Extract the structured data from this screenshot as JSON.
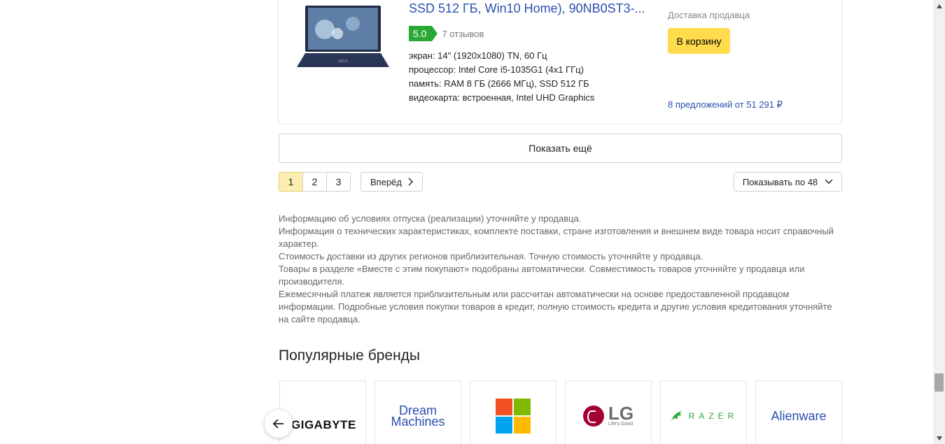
{
  "product": {
    "title": "SSD 512 ГБ, Win10 Home), 90NB0ST3-...",
    "rating": "5.0",
    "reviews": "7 отзывов",
    "specs": [
      "экран: 14\" (1920x1080) TN, 60 Гц",
      "процессор: Intel Core i5-1035G1 (4x1 ГГц)",
      "память: RAM 8 ГБ (2666 МГц), SSD 512 ГБ",
      "видеокарта: встроенная, Intel UHD Graphics"
    ],
    "delivery": "Доставка продавца",
    "cart_label": "В корзину",
    "offers": "8 предложений от 51 291 ₽",
    "image_logo": "ASUS"
  },
  "show_more_label": "Показать ещё",
  "pagination": {
    "pages": [
      "1",
      "2",
      "3"
    ],
    "active": "1",
    "next_label": "Вперёд",
    "per_page_label": "Показывать по 48"
  },
  "disclaimer": [
    "Информацию об условиях отпуска (реализации) уточняйте у продавца.",
    "Информация о технических характеристиках, комплекте поставки, стране изготовления и внешнем виде товара носит справочный характер.",
    "Стоимость доставки из других регионов приблизительная. Точную стоимость уточняйте у продавца.",
    "Товары в разделе «Вместе с этим покупают» подобраны автоматически. Совместимость товаров уточняйте у продавца или производителя.",
    "Ежемесячный платеж является приблизительным или рассчитан автоматически на основе предоставленной продавцом информации. Подробные условия покупки товаров в кредит, полную стоимость кредита и другие условия кредитования уточняйте на сайте продавца."
  ],
  "brands": {
    "title": "Популярные бренды",
    "items": [
      {
        "name": "GIGABYTE"
      },
      {
        "name": "Dream Machines",
        "line1": "Dream",
        "line2": "Machines"
      },
      {
        "name": "Microsoft"
      },
      {
        "name": "LG",
        "sub": "Life's Good"
      },
      {
        "name": "RAZER"
      },
      {
        "name": "Alienware"
      }
    ]
  },
  "colors": {
    "accent_yellow": "#ffdb4d",
    "link_blue": "#2b4fb0",
    "rating_green": "#2aa836",
    "ms_red": "#f25022",
    "ms_green": "#7fba00",
    "ms_blue": "#00a4ef",
    "ms_yellow": "#ffb900"
  }
}
